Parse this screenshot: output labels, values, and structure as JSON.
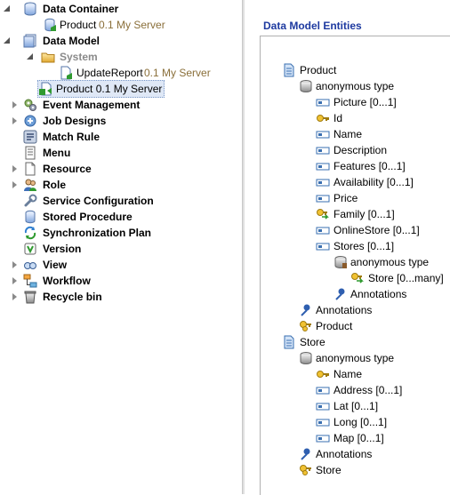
{
  "tree": {
    "data_container": "Data Container",
    "product_dc": "Product",
    "product_dc_meta": "0.1 My Server",
    "data_model": "Data Model",
    "system": "System",
    "update_report": "UpdateReport",
    "update_report_meta": "0.1 My Server",
    "product_dm": "Product 0.1 My Server",
    "event_management": "Event Management",
    "job_designs": "Job Designs",
    "match_rule": "Match Rule",
    "menu": "Menu",
    "resource": "Resource",
    "role": "Role",
    "service_configuration": "Service Configuration",
    "stored_procedure": "Stored Procedure",
    "synchronization_plan": "Synchronization Plan",
    "version": "Version",
    "view": "View",
    "workflow": "Workflow",
    "recycle_bin": "Recycle bin"
  },
  "entities": {
    "title": "Data Model Entities",
    "product": "Product",
    "anon1": "anonymous type",
    "picture": "Picture  [0...1]",
    "id": "Id",
    "name": "Name",
    "description": "Description",
    "features": "Features  [0...1]",
    "availability": "Availability  [0...1]",
    "price": "Price",
    "family": "Family  [0...1]",
    "onlinestore": "OnlineStore  [0...1]",
    "stores": "Stores  [0...1]",
    "anon2": "anonymous type",
    "store_ref": "Store  [0...many]",
    "annotations_inner": "Annotations",
    "annotations_product": "Annotations",
    "product_key": "Product",
    "store": "Store",
    "anon3": "anonymous type",
    "store_name": "Name",
    "address": "Address  [0...1]",
    "lat": "Lat  [0...1]",
    "long": "Long  [0...1]",
    "map": "Map  [0...1]",
    "annotations_store": "Annotations",
    "store_key": "Store"
  }
}
